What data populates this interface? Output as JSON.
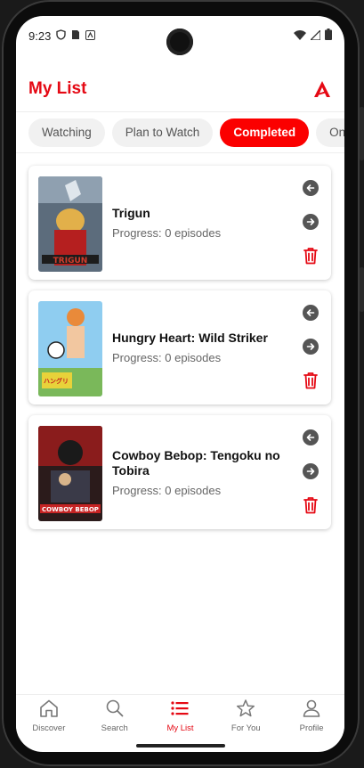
{
  "status_bar": {
    "time": "9:23",
    "left_icons": [
      "shield-icon",
      "sim-icon",
      "app-notification-icon"
    ],
    "right_icons": [
      "wifi-icon",
      "signal-icon",
      "battery-icon"
    ]
  },
  "header": {
    "title": "My List",
    "logo_icon": "app-logo-icon",
    "accent_color": "#e50914"
  },
  "tabs": [
    {
      "label": "Watching",
      "active": false
    },
    {
      "label": "Plan to Watch",
      "active": false
    },
    {
      "label": "Completed",
      "active": true
    },
    {
      "label": "On Hold",
      "active": false
    }
  ],
  "list": {
    "items": [
      {
        "title": "Trigun",
        "progress": "Progress: 0 episodes"
      },
      {
        "title": "Hungry Heart: Wild Striker",
        "progress": "Progress: 0 episodes"
      },
      {
        "title": "Cowboy Bebop: Tengoku no Tobira",
        "progress": "Progress: 0 episodes"
      }
    ],
    "item_actions": [
      "arrow-left-icon",
      "arrow-right-icon",
      "trash-icon"
    ]
  },
  "bottom_nav": [
    {
      "label": "Discover",
      "icon": "home-icon",
      "active": false
    },
    {
      "label": "Search",
      "icon": "search-icon",
      "active": false
    },
    {
      "label": "My List",
      "icon": "list-icon",
      "active": true
    },
    {
      "label": "For You",
      "icon": "star-icon",
      "active": false
    },
    {
      "label": "Profile",
      "icon": "person-icon",
      "active": false
    }
  ]
}
